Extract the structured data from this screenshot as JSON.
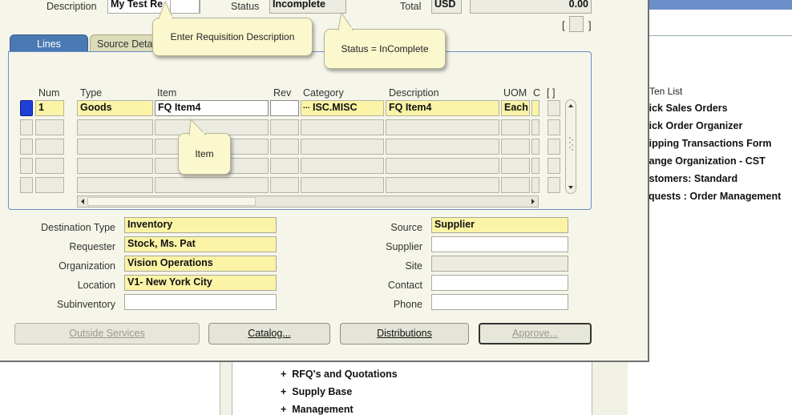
{
  "header": {
    "description_label": "Description",
    "description_value": "My Test Re",
    "status_label": "Status",
    "status_value": "Incomplete",
    "total_label": "Total",
    "currency": "USD",
    "total_value": "0.00",
    "bracket_left": "[",
    "bracket_right": "]"
  },
  "tabs": [
    {
      "label": "Lines"
    },
    {
      "label": "Source Deta"
    }
  ],
  "lines": {
    "columns": [
      "Num",
      "Type",
      "Item",
      "Rev",
      "Category",
      "Description",
      "UOM",
      "C",
      "[ ]"
    ],
    "rows": [
      {
        "num": "1",
        "type": "Goods",
        "item": "FQ Item4",
        "rev": "",
        "category": "ISC.MISC",
        "description": "FQ Item4",
        "uom": "Each"
      }
    ],
    "category_lov": "..."
  },
  "details": {
    "left": [
      {
        "label": "Destination Type",
        "value": "Inventory"
      },
      {
        "label": "Requester",
        "value": "Stock, Ms. Pat"
      },
      {
        "label": "Organization",
        "value": "Vision Operations"
      },
      {
        "label": "Location",
        "value": "V1- New York City"
      },
      {
        "label": "Subinventory",
        "value": ""
      }
    ],
    "right": [
      {
        "label": "Source",
        "value": "Supplier"
      },
      {
        "label": "Supplier",
        "value": ""
      },
      {
        "label": "Site",
        "value": ""
      },
      {
        "label": "Contact",
        "value": ""
      },
      {
        "label": "Phone",
        "value": ""
      }
    ]
  },
  "buttons": {
    "outside_services": "Outside Services",
    "catalog": "Catalog...",
    "distributions": "Distributions",
    "approve": "Approve..."
  },
  "tooltips": {
    "description": "Enter Requisition Description",
    "status": "Status = InComplete",
    "item": "Item"
  },
  "navigator": {
    "top_ten_label": "Ten List",
    "top_ten": [
      "uick Sales Orders",
      "uick Order Organizer",
      "hipping Transactions Form",
      "hange Organization - CST",
      "ustomers:  Standard",
      "equests : Order Management"
    ],
    "tree": [
      "RFQ's and Quotations",
      "Supply Base",
      "Management"
    ],
    "tree_marker": "+"
  },
  "colors": {
    "required_field": "#fbf4a6",
    "active_tab": "#4a79b4",
    "tooltip_bg": "#fbf8cd",
    "record_indicator": "#1f3fd6"
  }
}
